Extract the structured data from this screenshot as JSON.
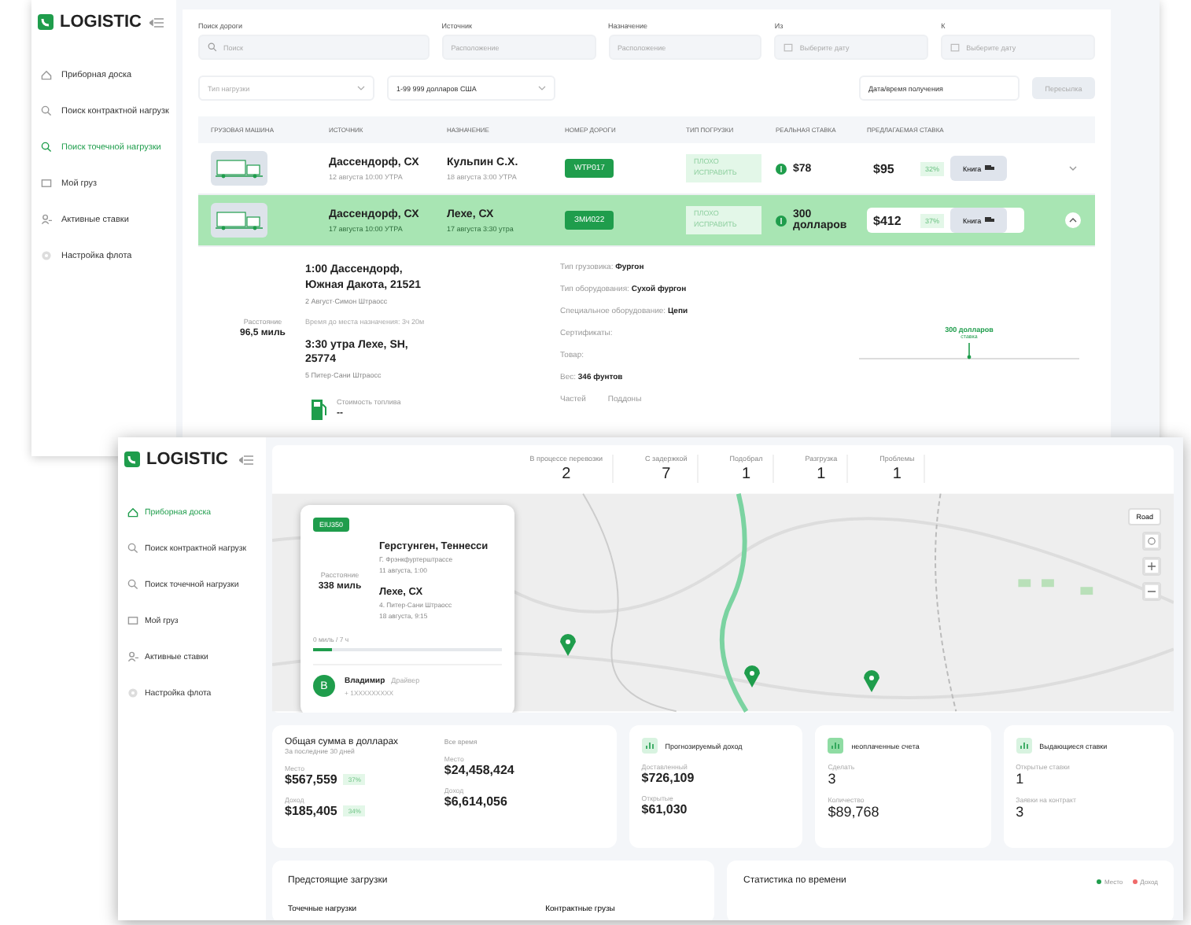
{
  "back_window": {
    "logo": "LOGISTIC",
    "nav": [
      {
        "label": "Приборная доска",
        "kind": "home",
        "selected": false
      },
      {
        "label": "Поиск контрактной нагрузк",
        "kind": "search",
        "selected": false
      },
      {
        "label": "Поиск точечной нагрузки",
        "kind": "search",
        "selected": true
      },
      {
        "label": "Мой груз",
        "kind": "box",
        "selected": false
      },
      {
        "label": "Активные ставки",
        "kind": "person",
        "selected": false
      },
      {
        "label": "Настройка флота",
        "kind": "gear",
        "selected": false
      }
    ],
    "filters": [
      {
        "label": "Поиск дороги",
        "placeholder": "Поиск",
        "kind": "search"
      },
      {
        "label": "Источник",
        "placeholder": "Расположение",
        "kind": "text"
      },
      {
        "label": "Назначение",
        "placeholder": "Расположение",
        "kind": "text"
      },
      {
        "label": "Из",
        "placeholder": "Выберите дату",
        "kind": "date"
      },
      {
        "label": "К",
        "placeholder": "Выберите дату",
        "kind": "date"
      }
    ],
    "selects": [
      {
        "placeholder": "Тип нагрузки"
      },
      {
        "value": "1-99 999 долларов США"
      }
    ],
    "sort": {
      "value": "Дата/время получения",
      "button": "Пересылка"
    },
    "table": {
      "columns": [
        "ГРУЗОВАЯ МАШИНА",
        "ИСТОЧНИК",
        "НАЗНАЧЕНИЕ",
        "НОМЕР ДОРОГИ",
        "ТИП ПОГРУЗКИ",
        "РЕАЛЬНАЯ СТАВКА",
        "ПРЕДЛАГАЕМАЯ СТАВКА"
      ],
      "rows": [
        {
          "origin": "Дассендорф, СХ",
          "origin_time": "12 августа 10:00 УТРА",
          "dest": "Кульпин С.Х.",
          "dest_time": "18 августа 3:00 УТРА",
          "number": "WTP017",
          "type": "ПЛОХО ИСПРАВИТЬ",
          "rate": "$78",
          "offer": "$95",
          "percent": "32%",
          "button": "Книга",
          "selected": false,
          "expanded": false
        },
        {
          "origin": "Дассендорф, СХ",
          "origin_time": "17 августа 10:00 УТРА",
          "dest": "Лехе, СХ",
          "dest_time": "17 августа 3:30 утра",
          "number": "ЗМИ022",
          "type": "ПЛОХО ИСПРАВИТЬ",
          "rate": "300 долларов",
          "offer": "$412",
          "percent": "37%",
          "button": "Книга",
          "selected": true,
          "expanded": true,
          "detail": {
            "stops": [
              {
                "title": "1:00 Дассендорф, Южная Дакота, 21521",
                "sub": "2 Август·Симон Штраосс"
              },
              {
                "title": "3:30 утра Лехе, SH, 25774",
                "sub": "5 Питер·Сани Штраосс"
              }
            ],
            "eta": "Время до места назначения: 3ч 20м",
            "distance_label": "Расстояние",
            "distance": "96,5 миль",
            "fuel_label": "Стоимость топлива",
            "fuel": "--",
            "specs": [
              {
                "label": "Тип грузовика:",
                "value": "Фургон"
              },
              {
                "label": "Тип оборудования:",
                "value": "Сухой фургон"
              },
              {
                "label": "Специальное оборудование:",
                "value": "Цепи"
              },
              {
                "label": "Сертификаты:"
              },
              {
                "label": "Товар:"
              },
              {
                "label": "Вес:",
                "value": "346 фунтов"
              }
            ],
            "parts": [
              "Частей",
              "Поддоны"
            ],
            "marker": {
              "label": "300 долларов",
              "sub": "ставка"
            }
          }
        }
      ]
    }
  },
  "front_window": {
    "logo": "LOGISTIC",
    "nav": [
      {
        "label": "Приборная доска",
        "kind": "home",
        "selected": true
      },
      {
        "label": "Поиск контрактной нагрузк",
        "kind": "search",
        "selected": false
      },
      {
        "label": "Поиск точечной нагрузки",
        "kind": "search",
        "selected": false
      },
      {
        "label": "Мой груз",
        "kind": "box",
        "selected": false
      },
      {
        "label": "Активные ставки",
        "kind": "person",
        "selected": false
      },
      {
        "label": "Настройка флота",
        "kind": "gear",
        "selected": false
      }
    ],
    "stats": [
      {
        "label": "В процессе перевозки",
        "value": "2"
      },
      {
        "label": "С задержкой",
        "value": "7"
      },
      {
        "label": "Подобрал",
        "value": "1"
      },
      {
        "label": "Разгрузка",
        "value": "1"
      },
      {
        "label": "Проблемы",
        "value": "1"
      }
    ],
    "map": {
      "kind": "picture",
      "layer_button": "Road",
      "popup": {
        "badge": "EIU350",
        "distance_label": "Расстояние",
        "distance": "338 миль",
        "stops": [
          {
            "place": "Герстунген, Теннесси",
            "street": "Г. Фрэнкфуртерштрассе",
            "time": "11 августа, 1:00"
          },
          {
            "place": "Лехе, СХ",
            "street": "4. Питер·Сани Штраосс",
            "time": "18 августа, 9:15"
          }
        ],
        "progress_label": "0 миль / 7 ч",
        "level": 0.1,
        "driver": {
          "initial": "В",
          "name": "Владимир",
          "role": "Драйвер",
          "phone": "+ 1XXXXXXXXX"
        }
      }
    },
    "summary": {
      "title": "Общая сумма в долларах",
      "columns": [
        {
          "period": "За последние 30 дней",
          "metrics": [
            {
              "label": "Место",
              "value": "$567,559",
              "badge": "37%"
            },
            {
              "label": "Доход",
              "value": "$185,405",
              "badge": "34%"
            }
          ]
        },
        {
          "period": "Все время",
          "metrics": [
            {
              "label": "Место",
              "value": "$24,458,424"
            },
            {
              "label": "Доход",
              "value": "$6,614,056"
            }
          ]
        }
      ]
    },
    "cards": [
      {
        "title": "Прогнозируемый доход",
        "metrics": [
          {
            "label": "Доставленный",
            "value": "$726,109"
          },
          {
            "label": "Открытые",
            "value": "$61,030"
          }
        ]
      },
      {
        "title": "неоплаченные счета",
        "metrics": [
          {
            "label": "Сделать",
            "value": "3"
          },
          {
            "label": "Количество",
            "value": "$89,768"
          }
        ]
      },
      {
        "title": "Выдающиеся ставки",
        "metrics": [
          {
            "label": "Открытые ставки",
            "value": "1"
          },
          {
            "label": "Заявки на контракт",
            "value": "3"
          }
        ]
      }
    ],
    "upcoming": {
      "title": "Предстоящие загрузки",
      "tabs": [
        "Точечные нагрузки",
        "Контрактные грузы"
      ]
    },
    "timeline": {
      "title": "Статистика по времени",
      "legend": [
        {
          "label": "Место",
          "color": "#1f9d4c"
        },
        {
          "label": "Доход",
          "color": "#f06a6a"
        }
      ]
    }
  }
}
